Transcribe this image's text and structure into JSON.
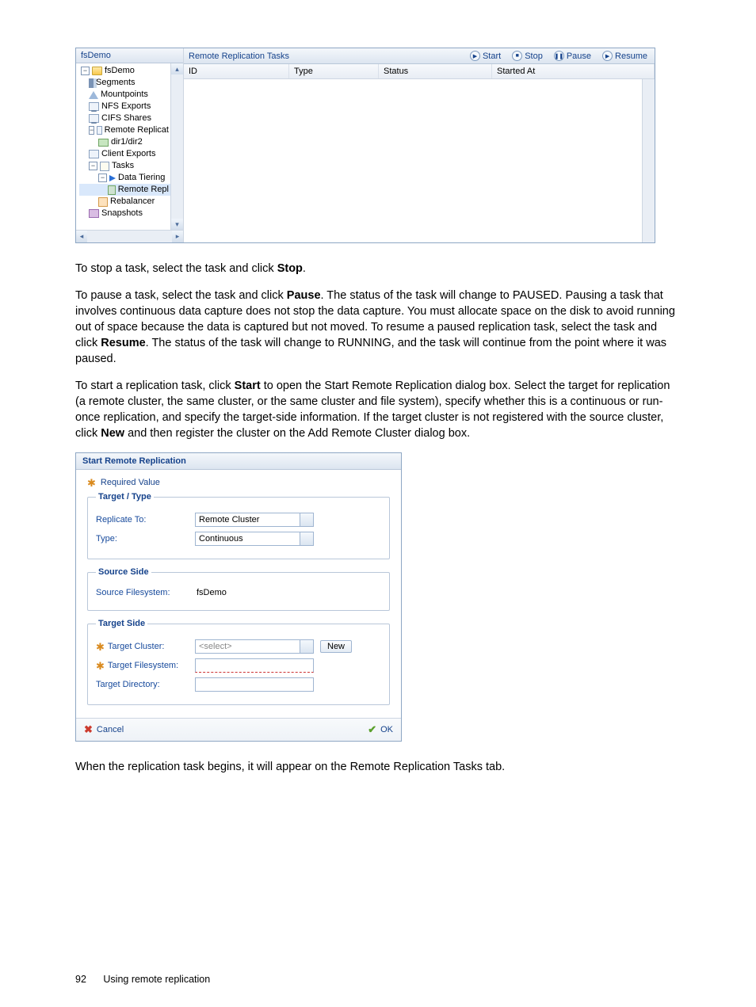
{
  "panel1": {
    "treeHeader": "fsDemo",
    "toolbarTitle": "Remote Replication Tasks",
    "buttons": {
      "start": "Start",
      "stop": "Stop",
      "pause": "Pause",
      "resume": "Resume"
    },
    "columns": {
      "id": "ID",
      "type": "Type",
      "status": "Status",
      "startedAt": "Started At"
    },
    "tree": {
      "root": "fsDemo",
      "segments": "Segments",
      "mountpoints": "Mountpoints",
      "nfs": "NFS Exports",
      "cifs": "CIFS Shares",
      "remoteReplicat": "Remote Replicat",
      "dir": "dir1/dir2",
      "clientExports": "Client Exports",
      "tasks": "Tasks",
      "dataTiering": "Data Tiering",
      "remoteRepl": "Remote Repl",
      "rebalancer": "Rebalancer",
      "snapshots": "Snapshots"
    }
  },
  "copy": {
    "p1a": "To stop a task, select the task and click ",
    "p1b": "Stop",
    "p1c": ".",
    "p2a": "To pause a task, select the task and click ",
    "p2b": "Pause",
    "p2c": ". The status of the task will change to PAUSED. Pausing a task that involves continuous data capture does not stop the data capture. You must allocate space on the disk to avoid running out of space because the data is captured but not moved. To resume a paused replication task, select the task and click ",
    "p2d": "Resume",
    "p2e": ". The status of the task will change to RUNNING, and the task will continue from the point where it was paused.",
    "p3a": "To start a replication task, click ",
    "p3b": "Start",
    "p3c": " to open the Start Remote Replication dialog box. Select the target for replication (a remote cluster, the same cluster, or the same cluster and file system), specify whether this is a continuous or run-once replication, and specify the target-side information. If the target cluster is not registered with the source cluster, click ",
    "p3d": "New",
    "p3e": " and then register the cluster on the Add Remote Cluster dialog box.",
    "p4": "When the replication task begins, it will appear on the Remote Replication Tasks tab."
  },
  "dlg": {
    "title": "Start Remote Replication",
    "required": "Required Value",
    "sectionTargetType": "Target / Type",
    "replicateTo": "Replicate To:",
    "replicateToValue": "Remote Cluster",
    "type": "Type:",
    "typeValue": "Continuous",
    "sectionSource": "Source Side",
    "sourceFs": "Source Filesystem:",
    "sourceFsValue": "fsDemo",
    "sectionTarget": "Target Side",
    "targetCluster": "Target Cluster:",
    "targetClusterValue": "<select>",
    "new": "New",
    "targetFs": "Target Filesystem:",
    "targetDir": "Target Directory:",
    "cancel": "Cancel",
    "ok": "OK"
  },
  "footer": {
    "pageNum": "92",
    "section": "Using remote replication"
  }
}
